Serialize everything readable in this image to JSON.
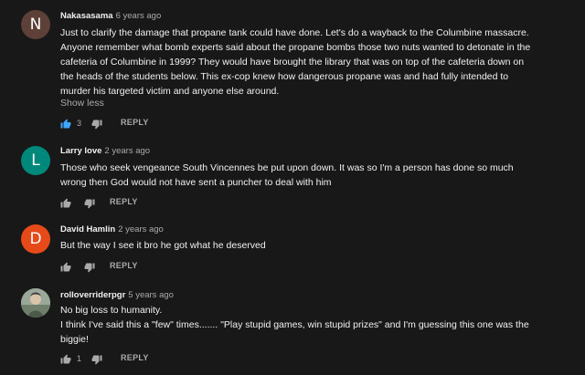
{
  "comments": [
    {
      "avatar_letter": "N",
      "avatar_color": "#5d4037",
      "author": "Nakasasama",
      "time": "6 years ago",
      "lines": [
        "Just to clarify the damage that propane tank could have done. Let's do a wayback to the Columbine massacre.",
        "Anyone remember what bomb experts said about the propane bombs those two nuts wanted to detonate in the",
        "cafeteria of Columbine in 1999? They would have brought the library that was on top of the cafeteria down on",
        "the heads of the students below. This ex-cop knew how dangerous propane was and had fully intended to",
        "murder his targeted victim and anyone else around."
      ],
      "show_less": "Show less",
      "like_count": "3",
      "reply_label": "REPLY",
      "liked": true
    },
    {
      "avatar_letter": "L",
      "avatar_color": "#00897b",
      "author": "Larry love",
      "time": "2 years ago",
      "lines": [
        "Those who seek vengeance South Vincennes be put upon down. It was so I'm a person has done so much",
        "wrong then God would not have sent a puncher to deal with him"
      ],
      "reply_label": "REPLY"
    },
    {
      "avatar_letter": "D",
      "avatar_color": "#e64a19",
      "author": "David Hamlin",
      "time": "2 years ago",
      "lines": [
        "But the way I see it bro he got what he deserved"
      ],
      "reply_label": "REPLY"
    },
    {
      "avatar_letter": "",
      "avatar_color": "#8a9a88",
      "author": "rolloverriderpgr",
      "time": "5 years ago",
      "lines": [
        "No big loss to humanity.",
        "I think I've said this a \"few\" times....... \"Play stupid games, win stupid prizes\" and I'm guessing this one was the",
        "biggie!"
      ],
      "like_count": "1",
      "reply_label": "REPLY"
    }
  ]
}
